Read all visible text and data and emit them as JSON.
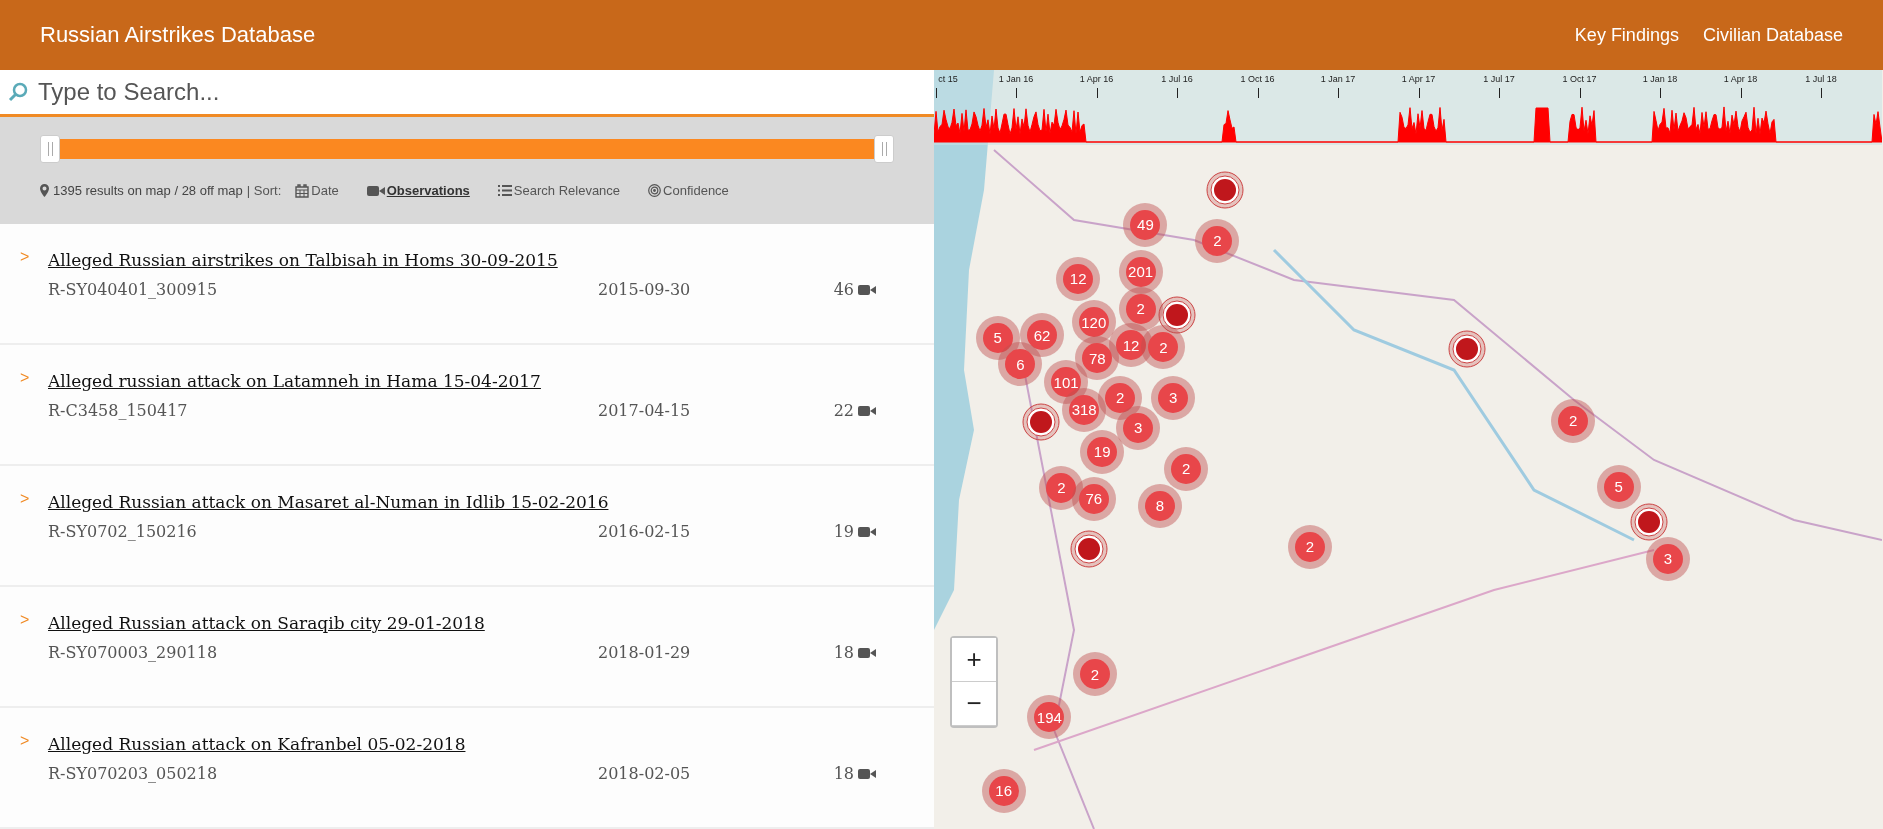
{
  "header": {
    "title": "Russian Airstrikes Database",
    "nav": [
      "Key Findings",
      "Civilian Database"
    ]
  },
  "search": {
    "placeholder": "Type to Search..."
  },
  "date_slider": {
    "level": 1
  },
  "results": {
    "summary": "1395 results on map / 28 off map",
    "sort_label": "| Sort:"
  },
  "sort_options": [
    {
      "label": "Date",
      "selected": false
    },
    {
      "label": "Observations",
      "selected": true
    },
    {
      "label": "Search Relevance",
      "selected": false
    },
    {
      "label": "Confidence",
      "selected": false
    }
  ],
  "incidents": [
    {
      "marker": ">",
      "title": "Alleged Russian airstrikes on Talbisah in Homs 30-09-2015",
      "code": "R-SY040401_300915",
      "date": "2015-09-30",
      "observations": "46"
    },
    {
      "marker": ">",
      "title": "Alleged russian attack on Latamneh in Hama 15-04-2017",
      "code": "R-C3458_150417",
      "date": "2017-04-15",
      "observations": "22"
    },
    {
      "marker": ">",
      "title": "Alleged Russian attack on Masaret al-Numan in Idlib 15-02-2016",
      "code": "R-SY0702_150216",
      "date": "2016-02-15",
      "observations": "19"
    },
    {
      "marker": ">",
      "title": "Alleged Russian attack on Saraqib city 29-01-2018",
      "code": "R-SY070003_290118",
      "date": "2018-01-29",
      "observations": "18"
    },
    {
      "marker": ">",
      "title": "Alleged Russian attack on Kafranbel 05-02-2018",
      "code": "R-SY070203_050218",
      "date": "2018-02-05",
      "observations": "18"
    }
  ],
  "timeline": {
    "ticks": [
      "ct 15",
      "1 Jan 16",
      "1 Apr 16",
      "1 Jul 16",
      "1 Oct 16",
      "1 Jan 17",
      "1 Apr 17",
      "1 Jul 17",
      "1 Oct 17",
      "1 Jan 18",
      "1 Apr 18",
      "1 Jul 18"
    ]
  },
  "map": {
    "markers": [
      {
        "kind": "single"
      },
      {
        "kind": "cluster",
        "count": "49"
      },
      {
        "kind": "cluster",
        "count": "2"
      },
      {
        "kind": "cluster",
        "count": "12"
      },
      {
        "kind": "cluster",
        "count": "201"
      },
      {
        "kind": "single"
      },
      {
        "kind": "cluster",
        "count": "2"
      },
      {
        "kind": "cluster",
        "count": "120"
      },
      {
        "kind": "cluster",
        "count": "5"
      },
      {
        "kind": "cluster",
        "count": "62"
      },
      {
        "kind": "cluster",
        "count": "6"
      },
      {
        "kind": "cluster",
        "count": "12"
      },
      {
        "kind": "cluster",
        "count": "2"
      },
      {
        "kind": "cluster",
        "count": "78"
      },
      {
        "kind": "cluster",
        "count": "101"
      },
      {
        "kind": "single"
      },
      {
        "kind": "cluster",
        "count": "2"
      },
      {
        "kind": "cluster",
        "count": "3"
      },
      {
        "kind": "cluster",
        "count": "318"
      },
      {
        "kind": "single"
      },
      {
        "kind": "cluster",
        "count": "3"
      },
      {
        "kind": "cluster",
        "count": "2"
      },
      {
        "kind": "cluster",
        "count": "19"
      },
      {
        "kind": "cluster",
        "count": "2"
      },
      {
        "kind": "cluster",
        "count": "2"
      },
      {
        "kind": "cluster",
        "count": "76"
      },
      {
        "kind": "cluster",
        "count": "8"
      },
      {
        "kind": "cluster",
        "count": "5"
      },
      {
        "kind": "single"
      },
      {
        "kind": "cluster",
        "count": "2"
      },
      {
        "kind": "single"
      },
      {
        "kind": "cluster",
        "count": "3"
      },
      {
        "kind": "cluster",
        "count": "2"
      },
      {
        "kind": "cluster",
        "count": "194"
      },
      {
        "kind": "cluster",
        "count": "16"
      }
    ],
    "zoom": [
      "+",
      "−"
    ]
  }
}
